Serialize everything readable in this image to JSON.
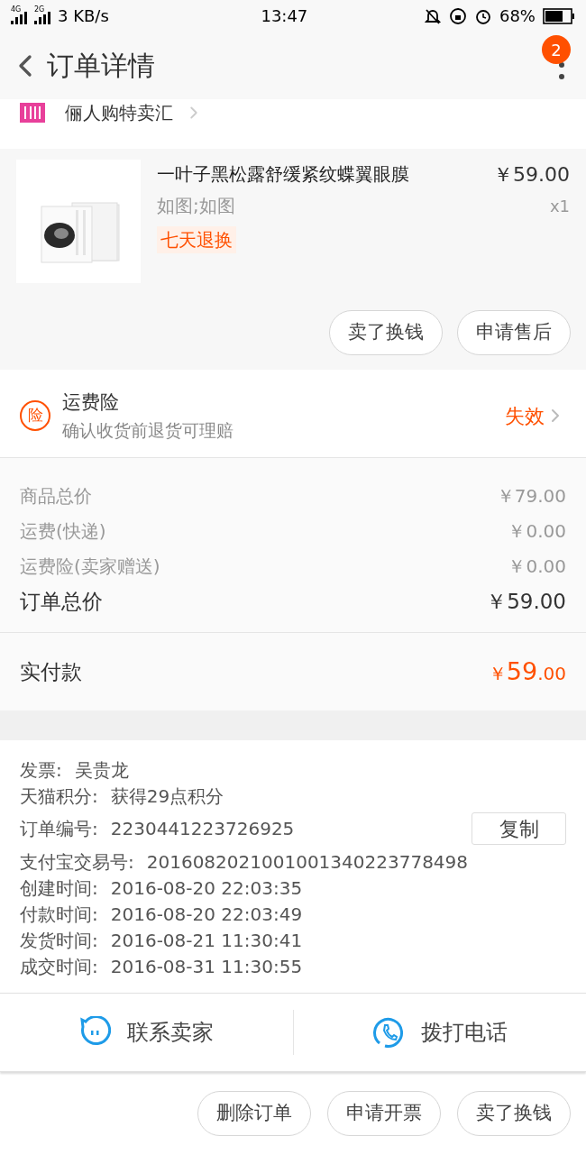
{
  "status_bar": {
    "network_1": "4G",
    "network_2": "2G",
    "speed": "3 KB/s",
    "time": "13:47",
    "battery": "68%"
  },
  "header": {
    "title": "订单详情",
    "badge": "2"
  },
  "shop": {
    "name": "俪人购特卖汇"
  },
  "product": {
    "kind": "picture",
    "name": "一叶子黑松露舒缓紧纹蝶翼眼膜",
    "spec": "如图;如图",
    "tag": "七天退换",
    "price": "￥59.00",
    "quantity": "x1",
    "actions": [
      "卖了换钱",
      "申请售后"
    ]
  },
  "insurance": {
    "title": "运费险",
    "icon": "险",
    "subtitle": "确认收货前退货可理赔",
    "status": "失效"
  },
  "costs": [
    {
      "label": "商品总价",
      "value": "￥79.00"
    },
    {
      "label": "运费(快递)",
      "value": "￥0.00"
    },
    {
      "label": "运费险(卖家赠送)",
      "value": "￥0.00"
    }
  ],
  "order_total": {
    "label": "订单总价",
    "value": "￥59.00"
  },
  "paid": {
    "label": "实付款",
    "currency": "￥",
    "integer": "59",
    "decimal": ".00"
  },
  "info": [
    {
      "label": "发票:",
      "value": "吴贵龙"
    },
    {
      "label": "天猫积分:",
      "value": "获得29点积分"
    },
    {
      "label": "订单编号:",
      "value": "2230441223726925",
      "action": "复制"
    },
    {
      "label": "支付宝交易号:",
      "value": "2016082021001001340223778498"
    },
    {
      "label": "创建时间:",
      "value": "2016-08-20 22:03:35"
    },
    {
      "label": "付款时间:",
      "value": "2016-08-20 22:03:49"
    },
    {
      "label": "发货时间:",
      "value": "2016-08-21 11:30:41"
    },
    {
      "label": "成交时间:",
      "value": "2016-08-31 11:30:55"
    }
  ],
  "contact": [
    {
      "kind": "chat",
      "label": "联系卖家"
    },
    {
      "kind": "phone",
      "label": "拨打电话"
    }
  ],
  "bottom_actions": [
    "删除订单",
    "申请开票",
    "卖了换钱"
  ]
}
